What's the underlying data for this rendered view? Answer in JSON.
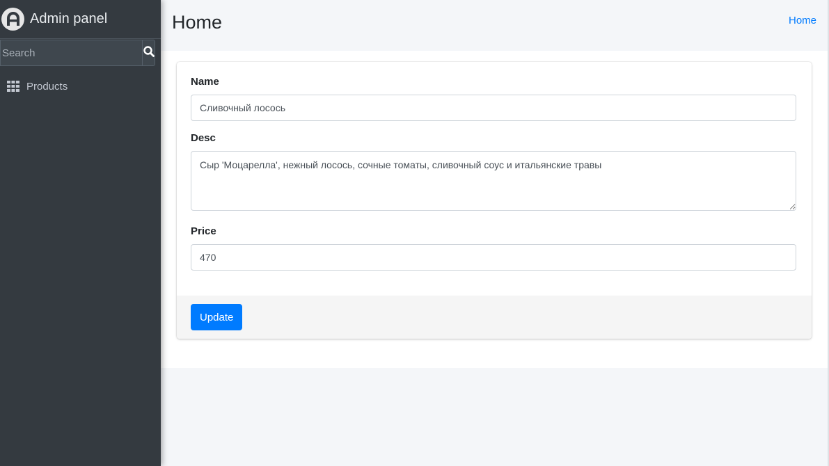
{
  "brand": {
    "title": "Admin panel",
    "logo_icon": "admin-logo-icon"
  },
  "search": {
    "placeholder": "Search",
    "icon": "search-icon"
  },
  "sidebar": {
    "items": [
      {
        "label": "Products",
        "icon": "grid-icon"
      }
    ]
  },
  "header": {
    "title": "Home",
    "breadcrumb": "Home"
  },
  "form": {
    "name_label": "Name",
    "name_value": "Сливочный лосось",
    "desc_label": "Desc",
    "desc_value": "Сыр 'Моцарелла', нежный лосось, сочные томаты, сливочный соус и итальянские травы",
    "price_label": "Price",
    "price_value": "470",
    "submit_label": "Update"
  },
  "colors": {
    "sidebar_bg": "#343a40",
    "accent": "#007bff",
    "page_bg": "#f4f6f9"
  }
}
